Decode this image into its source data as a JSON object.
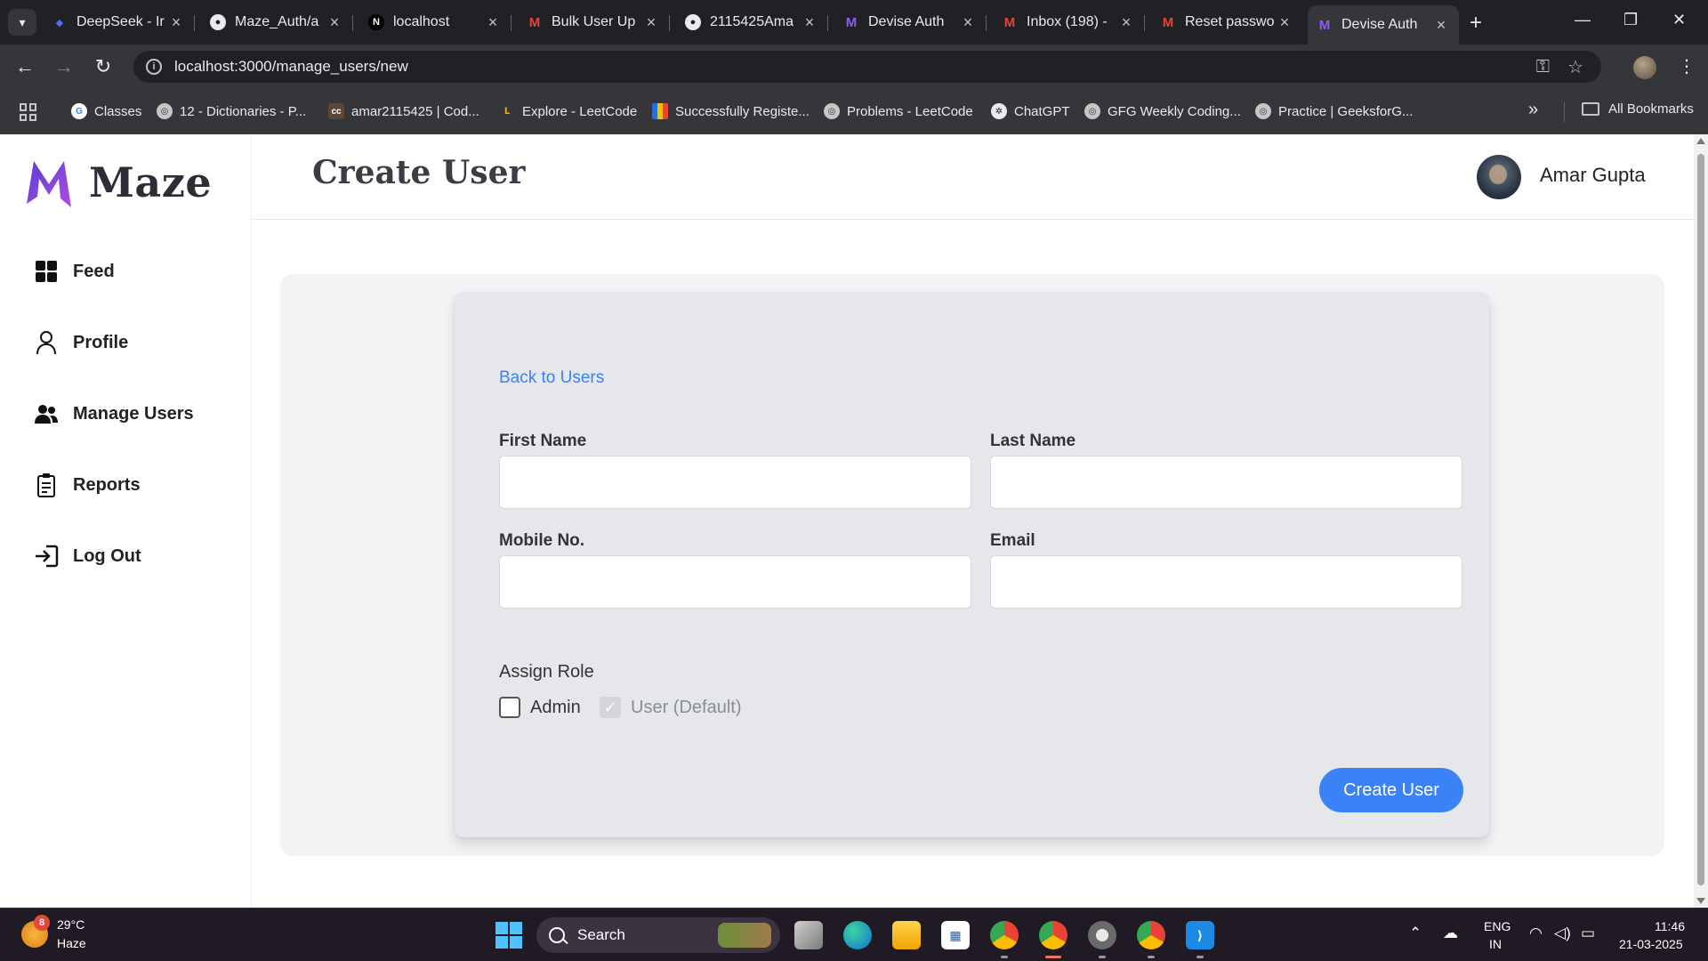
{
  "browser": {
    "tabs": [
      {
        "title": "DeepSeek - Ir",
        "icon": "deepseek-icon",
        "active": false
      },
      {
        "title": "Maze_Auth/a",
        "icon": "github-icon",
        "active": false
      },
      {
        "title": "localhost",
        "icon": "nextjs-icon",
        "active": false
      },
      {
        "title": "Bulk User Up",
        "icon": "gmail-icon",
        "active": false
      },
      {
        "title": "2115425Ama",
        "icon": "github-icon",
        "active": false
      },
      {
        "title": "Devise Auth",
        "icon": "maze-icon",
        "active": false
      },
      {
        "title": "Inbox (198) -",
        "icon": "gmail-icon",
        "active": false
      },
      {
        "title": "Reset passwo",
        "icon": "gmail-icon",
        "active": false
      },
      {
        "title": "Devise Auth",
        "icon": "maze-icon",
        "active": true
      }
    ],
    "url": "localhost:3000/manage_users/new",
    "bookmarks": [
      {
        "label": "Classes",
        "icon": "google-icon"
      },
      {
        "label": "12 - Dictionaries - P...",
        "icon": "globe-icon"
      },
      {
        "label": "amar2115425 | Cod...",
        "icon": "codechef-icon"
      },
      {
        "label": "Explore - LeetCode",
        "icon": "leetcode-icon"
      },
      {
        "label": "Successfully Registe...",
        "icon": "chart-icon"
      },
      {
        "label": "Problems - LeetCode",
        "icon": "globe-icon"
      },
      {
        "label": "ChatGPT",
        "icon": "chatgpt-icon"
      },
      {
        "label": "GFG Weekly Coding...",
        "icon": "globe-icon"
      },
      {
        "label": "Practice | GeeksforG...",
        "icon": "globe-icon"
      }
    ],
    "all_bookmarks": "All Bookmarks"
  },
  "sidebar": {
    "logo_text": "Maze",
    "items": [
      {
        "label": "Feed",
        "icon": "grid-icon"
      },
      {
        "label": "Profile",
        "icon": "person-icon"
      },
      {
        "label": "Manage Users",
        "icon": "users-icon"
      },
      {
        "label": "Reports",
        "icon": "clipboard-icon"
      },
      {
        "label": "Log Out",
        "icon": "logout-icon"
      }
    ]
  },
  "header": {
    "title": "Create User",
    "user_name": "Amar Gupta"
  },
  "form": {
    "back_link": "Back to Users",
    "fields": {
      "first_name": {
        "label": "First Name",
        "value": ""
      },
      "last_name": {
        "label": "Last Name",
        "value": ""
      },
      "mobile": {
        "label": "Mobile No.",
        "value": ""
      },
      "email": {
        "label": "Email",
        "value": ""
      }
    },
    "assign_role_label": "Assign Role",
    "roles": {
      "admin": {
        "label": "Admin",
        "checked": false
      },
      "user": {
        "label": "User (Default)",
        "checked": true,
        "disabled": true
      }
    },
    "submit_label": "Create User"
  },
  "taskbar": {
    "weather_temp": "29°C",
    "weather_condition": "Haze",
    "weather_badge": "8",
    "search_label": "Search",
    "language": "ENG",
    "region": "IN",
    "time": "11:46",
    "date": "21-03-2025"
  },
  "colors": {
    "accent": "#3b82f6",
    "logo_purple": "#7c3aed"
  }
}
